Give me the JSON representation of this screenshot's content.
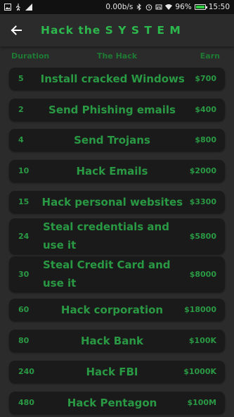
{
  "status": {
    "speed": "0.00b/s",
    "battery": "96%",
    "battery_level": 0.96,
    "time": "15:50"
  },
  "appbar": {
    "title": "Hack the  S Y S T E M"
  },
  "headers": {
    "duration": "Duration",
    "hack": "The Hack",
    "earn": "Earn"
  },
  "hacks": [
    {
      "duration": "5",
      "name": "Install cracked Windows",
      "earn": "$700"
    },
    {
      "duration": "2",
      "name": "Send Phishing emails",
      "earn": "$400"
    },
    {
      "duration": "4",
      "name": "Send Trojans",
      "earn": "$800"
    },
    {
      "duration": "10",
      "name": "Hack Emails",
      "earn": "$2000"
    },
    {
      "duration": "15",
      "name": "Hack personal websites",
      "earn": "$3300"
    },
    {
      "duration": "24",
      "name": "Steal credentials and use it",
      "earn": "$5800"
    },
    {
      "duration": "30",
      "name": "Steal Credit Card and use it",
      "earn": "$8000"
    },
    {
      "duration": "60",
      "name": "Hack corporation",
      "earn": "$18000"
    },
    {
      "duration": "80",
      "name": "Hack Bank",
      "earn": "$100K"
    },
    {
      "duration": "240",
      "name": "Hack FBI",
      "earn": "$1000K"
    },
    {
      "duration": "480",
      "name": "Hack Pentagon",
      "earn": "$100M"
    }
  ],
  "colors": {
    "accent": "#2db84d",
    "text_dim": "#2a9944",
    "background": "#2b2b2b",
    "card": "#1a1a1a"
  }
}
